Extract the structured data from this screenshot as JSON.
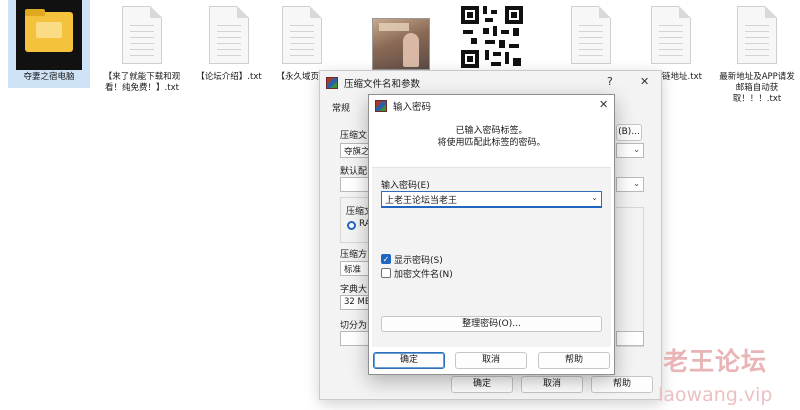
{
  "desktop": {
    "icons": [
      {
        "label": "夺妻之宿电脑",
        "kind": "folder"
      },
      {
        "label": "【来了就能下载和观看！纯免费！】.txt",
        "kind": "text"
      },
      {
        "label": "【论坛介绍】.txt",
        "kind": "text"
      },
      {
        "label": "【永久域页】",
        "kind": "text"
      },
      {
        "label": "",
        "kind": "game-image"
      },
      {
        "label": "",
        "kind": "qr-image"
      },
      {
        "label": "",
        "kind": "text"
      },
      {
        "label": "链地址.txt",
        "kind": "text"
      },
      {
        "label": "最新地址及APP请发邮箱自动获取！！！.txt",
        "kind": "text"
      }
    ]
  },
  "archive_dialog": {
    "title": "压缩文件名和参数",
    "help_btn": "?",
    "close_btn": "✕",
    "tab_general": "常规",
    "label_archive_name": "压缩文",
    "archive_name_value": "夺旗之",
    "browse_btn": "(B)...",
    "label_default": "默认配",
    "label_format": "压缩文",
    "format_rar": "RA",
    "label_method": "压缩方",
    "method_value": "标准",
    "label_dict": "字典大",
    "dict_value": "32 MB",
    "label_split": "切分为",
    "ok_btn": "确定",
    "cancel_btn": "取消",
    "help_label": "帮助"
  },
  "password_dialog": {
    "title": "输入密码",
    "close_btn": "✕",
    "info_line1": "已输入密码标签。",
    "info_line2": "将使用匹配此标签的密码。",
    "label_enter_password": "输入密码(E)",
    "password_value": "上老王论坛当老王",
    "show_password": "显示密码(S)",
    "show_password_checked": true,
    "encrypt_filenames": "加密文件名(N)",
    "encrypt_filenames_checked": false,
    "organize_btn": "整理密码(O)...",
    "ok_btn": "确定",
    "cancel_btn": "取消",
    "help_btn": "帮助"
  },
  "watermark": {
    "cn": "老王论坛",
    "en": "laowang.vip"
  },
  "colors": {
    "accent": "#1f66c1",
    "folder": "#f4c23c",
    "watermark": "#e8b4b6"
  }
}
